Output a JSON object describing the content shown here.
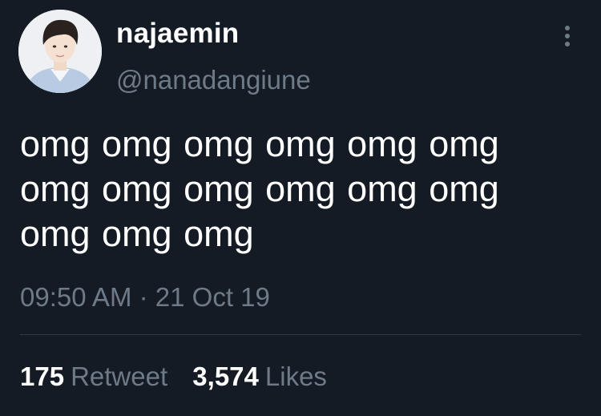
{
  "tweet": {
    "display_name": "najaemin",
    "handle": "@nanadangiune",
    "text_lines": [
      "omg omg omg omg omg omg",
      "omg omg omg omg omg omg",
      "omg omg omg"
    ],
    "time": "09:50 AM",
    "separator": "·",
    "date": "21 Oct 19",
    "retweets": {
      "count": "175",
      "label": "Retweet"
    },
    "likes": {
      "count": "3,574",
      "label": "Likes"
    }
  },
  "colors": {
    "background": "#151b24",
    "primary_text": "#ffffff",
    "secondary_text": "#6e7a87",
    "divider": "#2f3944"
  },
  "icons": {
    "more": "vertical-ellipsis-icon"
  }
}
